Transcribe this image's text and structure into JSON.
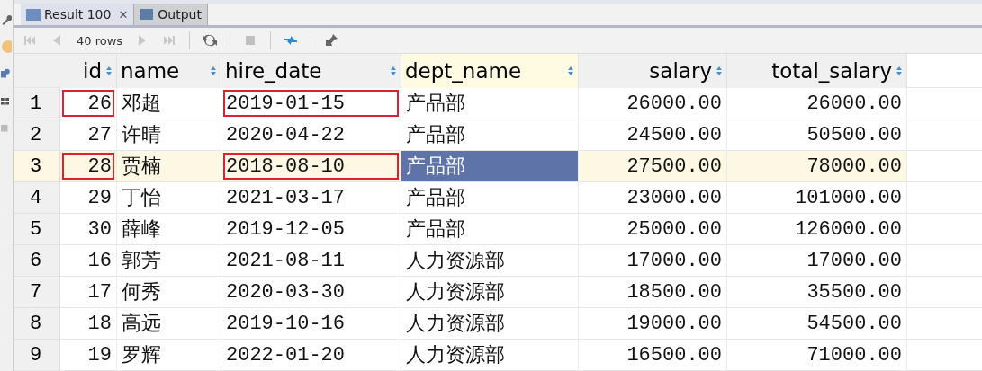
{
  "tabs": [
    {
      "label": "Result 100",
      "selected": true,
      "close": "✕"
    },
    {
      "label": "Output",
      "selected": false
    }
  ],
  "toolbar": {
    "row_count": "40 rows"
  },
  "columns": [
    {
      "label": "id",
      "kind": "number",
      "selected": false
    },
    {
      "label": "name",
      "kind": "text",
      "selected": false
    },
    {
      "label": "hire_date",
      "kind": "date",
      "selected": false
    },
    {
      "label": "dept_name",
      "kind": "text",
      "selected": true
    },
    {
      "label": "salary",
      "kind": "number",
      "selected": false
    },
    {
      "label": "total_salary",
      "kind": "number",
      "selected": false
    }
  ],
  "rows": [
    {
      "number": "1",
      "selected": false,
      "annotated": true,
      "cells": [
        "26",
        "邓超",
        "2019-01-15",
        "产品部",
        "26000.00",
        "26000.00"
      ]
    },
    {
      "number": "2",
      "selected": false,
      "annotated": false,
      "cells": [
        "27",
        "许晴",
        "2020-04-22",
        "产品部",
        "24500.00",
        "50500.00"
      ]
    },
    {
      "number": "3",
      "selected": true,
      "annotated": true,
      "cells": [
        "28",
        "贾楠",
        "2018-08-10",
        "产品部",
        "27500.00",
        "78000.00"
      ]
    },
    {
      "number": "4",
      "selected": false,
      "annotated": false,
      "cells": [
        "29",
        "丁怡",
        "2021-03-17",
        "产品部",
        "23000.00",
        "101000.00"
      ]
    },
    {
      "number": "5",
      "selected": false,
      "annotated": false,
      "cells": [
        "30",
        "薛峰",
        "2019-12-05",
        "产品部",
        "25000.00",
        "126000.00"
      ]
    },
    {
      "number": "6",
      "selected": false,
      "annotated": false,
      "cells": [
        "16",
        "郭芳",
        "2021-08-11",
        "人力资源部",
        "17000.00",
        "17000.00"
      ]
    },
    {
      "number": "7",
      "selected": false,
      "annotated": false,
      "cells": [
        "17",
        "何秀",
        "2020-03-30",
        "人力资源部",
        "18500.00",
        "35500.00"
      ]
    },
    {
      "number": "8",
      "selected": false,
      "annotated": false,
      "cells": [
        "18",
        "高远",
        "2019-10-16",
        "人力资源部",
        "19000.00",
        "54500.00"
      ]
    },
    {
      "number": "9",
      "selected": false,
      "annotated": false,
      "cells": [
        "19",
        "罗辉",
        "2022-01-20",
        "人力资源部",
        "16500.00",
        "71000.00"
      ]
    }
  ]
}
